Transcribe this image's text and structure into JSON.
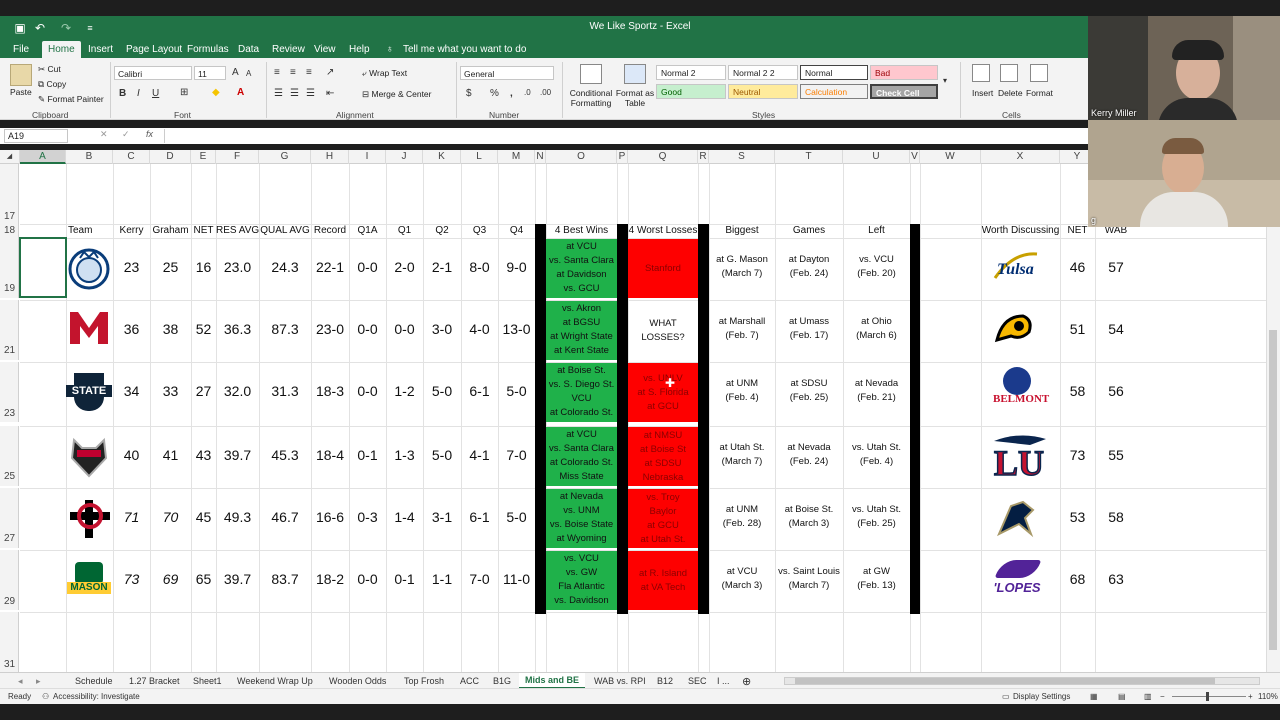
{
  "window": {
    "title": "We Like Sportz - Excel"
  },
  "menu": [
    "File",
    "Home",
    "Insert",
    "Page Layout",
    "Formulas",
    "Data",
    "Review",
    "View",
    "Help"
  ],
  "tell_me": "Tell me what you want to do",
  "ribbon": {
    "clipboard": {
      "paste": "Paste",
      "cut": "Cut",
      "copy": "Copy",
      "format_painter": "Format Painter",
      "label": "Clipboard"
    },
    "font": {
      "name": "Calibri",
      "size": "11",
      "label": "Font"
    },
    "alignment": {
      "wrap": "Wrap Text",
      "merge": "Merge & Center",
      "label": "Alignment"
    },
    "number": {
      "format": "General",
      "label": "Number"
    },
    "styles": {
      "conditional": "Conditional Formatting",
      "format_as_table": "Format as Table",
      "cells": [
        "Normal 2",
        "Normal 2 2",
        "Normal",
        "Bad",
        "Good",
        "Neutral",
        "Calculation",
        "Check Cell"
      ],
      "label": "Styles"
    },
    "cells": {
      "insert": "Insert",
      "delete": "Delete",
      "format": "Format",
      "label": "Cells"
    }
  },
  "formula_bar": {
    "name_box": "A19",
    "fx": "fx",
    "value": ""
  },
  "columns": [
    "A",
    "B",
    "C",
    "D",
    "E",
    "F",
    "G",
    "H",
    "I",
    "J",
    "K",
    "L",
    "M",
    "N",
    "O",
    "P",
    "Q",
    "R",
    "S",
    "T",
    "U",
    "V",
    "W",
    "X",
    "Y"
  ],
  "row_numbers": [
    "17",
    "18",
    "19",
    "21",
    "23",
    "25",
    "27",
    "29",
    "31"
  ],
  "headers": {
    "team": "Team",
    "kerry": "Kerry",
    "graham": "Graham",
    "net": "NET",
    "res_avg": "RES AVG",
    "qual_avg": "QUAL AVG",
    "record": "Record",
    "q1a": "Q1A",
    "q1": "Q1",
    "q2": "Q2",
    "q3": "Q3",
    "q4": "Q4",
    "best": "4 Best Wins",
    "worst": "4 Worst Losses",
    "biggest": "Biggest",
    "games": "Games",
    "left": "Left",
    "worth": "Worth Discussing",
    "net2": "NET",
    "wab": "WAB"
  },
  "rows": [
    {
      "logo": "saint-louis-billiken-logo",
      "kerry": "23",
      "graham": "25",
      "net": "16",
      "res": "23.0",
      "qual": "24.3",
      "record": "22-1",
      "q1a": "0-0",
      "q1": "2-0",
      "q2": "2-1",
      "q3": "8-0",
      "q4": "9-0",
      "best": "at VCU\nvs. Santa Clara\nat Davidson\nvs. GCU",
      "worst": "Stanford",
      "worst_color": "red",
      "biggest": "at G. Mason\n(March 7)",
      "games": "at Dayton\n(Feb. 24)",
      "left": "vs. VCU\n(Feb. 20)",
      "wlogo": "tulsa-logo",
      "wnet": "46",
      "wab": "57",
      "italic": false
    },
    {
      "logo": "miami-oh-logo",
      "kerry": "36",
      "graham": "38",
      "net": "52",
      "res": "36.3",
      "qual": "87.3",
      "record": "23-0",
      "q1a": "0-0",
      "q1": "0-0",
      "q2": "3-0",
      "q3": "4-0",
      "q4": "13-0",
      "best": "vs. Akron\nat BGSU\nat Wright State\nat Kent State",
      "worst": "WHAT LOSSES?",
      "worst_color": "white",
      "biggest": "at Marshall\n(Feb. 7)",
      "games": "at Umass\n(Feb. 17)",
      "left": "at Ohio\n(March 6)",
      "wlogo": "vcu-rams-logo",
      "wnet": "51",
      "wab": "54",
      "italic": false
    },
    {
      "logo": "utah-state-logo",
      "kerry": "34",
      "graham": "33",
      "net": "27",
      "res": "32.0",
      "qual": "31.3",
      "record": "18-3",
      "q1a": "0-0",
      "q1": "1-2",
      "q2": "5-0",
      "q3": "6-1",
      "q4": "5-0",
      "best": "at Boise St.\nvs. S. Diego St.\nVCU\nat Colorado St.",
      "worst": "vs. UNLV\nat S. Florida\nat GCU",
      "worst_color": "red",
      "biggest": "at UNM\n(Feb. 4)",
      "games": "at SDSU\n(Feb. 25)",
      "left": "at Nevada\n(Feb. 21)",
      "wlogo": "belmont-bruins-logo",
      "wnet": "58",
      "wab": "56",
      "italic": false
    },
    {
      "logo": "new-mexico-lobos-logo",
      "kerry": "40",
      "graham": "41",
      "net": "43",
      "res": "39.7",
      "qual": "45.3",
      "record": "18-4",
      "q1a": "0-1",
      "q1": "1-3",
      "q2": "5-0",
      "q3": "4-1",
      "q4": "7-0",
      "best": "at VCU\nvs. Santa Clara\nat Colorado St.\nMiss State",
      "worst": "at NMSU\nat Boise St\nat SDSU\nNebraska",
      "worst_color": "red",
      "biggest": "at Utah St.\n(March 7)",
      "games": "at Nevada\n(Feb. 24)",
      "left": "vs. Utah St.\n(Feb. 4)",
      "wlogo": "liberty-logo",
      "wnet": "73",
      "wab": "55",
      "italic": false
    },
    {
      "logo": "san-diego-state-logo",
      "kerry": "71",
      "graham": "70",
      "net": "45",
      "res": "49.3",
      "qual": "46.7",
      "record": "16-6",
      "q1a": "0-3",
      "q1": "1-4",
      "q2": "3-1",
      "q3": "6-1",
      "q4": "5-0",
      "best": "at Nevada\nvs. UNM\nvs. Boise State\nat Wyoming",
      "worst": "vs. Troy\nBaylor\nat GCU\nat Utah St.",
      "worst_color": "red",
      "biggest": "at UNM\n(Feb. 28)",
      "games": "at Boise St.\n(March 3)",
      "left": "vs. Utah St.\n(Feb. 25)",
      "wlogo": "akron-zips-logo",
      "wnet": "53",
      "wab": "58",
      "italic": true
    },
    {
      "logo": "george-mason-logo",
      "kerry": "73",
      "graham": "69",
      "net": "65",
      "res": "39.7",
      "qual": "83.7",
      "record": "18-2",
      "q1a": "0-0",
      "q1": "0-1",
      "q2": "1-1",
      "q3": "7-0",
      "q4": "11-0",
      "best": "vs. VCU\nvs. GW\nFla Atlantic\nvs. Davidson",
      "worst": "at R. Island\nat VA Tech",
      "worst_color": "red",
      "biggest": "at VCU\n(March 3)",
      "games": "vs. Saint Louis\n(March 7)",
      "left": "at GW\n(Feb. 13)",
      "wlogo": "gcu-lopes-logo",
      "wnet": "68",
      "wab": "63",
      "italic": true
    }
  ],
  "logo_text": {
    "utah": "STATE",
    "mason": "MASON",
    "belmont": "BELMONT",
    "lopes": "'LOPES"
  },
  "sheet_tabs": [
    "Schedule",
    "1.27 Bracket",
    "Sheet1",
    "Weekend Wrap Up",
    "Wooden Odds",
    "Top Frosh",
    "ACC",
    "B1G",
    "Mids and BE",
    "WAB vs. RPI",
    "B12",
    "SEC",
    "I ..."
  ],
  "active_tab": "Mids and BE",
  "status": {
    "ready": "Ready",
    "accessibility": "Accessibility: Investigate",
    "display": "Display Settings",
    "zoom": "110%"
  },
  "video": {
    "person1": "Kerry Miller",
    "person2": "g"
  },
  "colors": {
    "excel_green": "#217346",
    "win_green": "#1fb14a",
    "loss_red": "#fe0000"
  }
}
